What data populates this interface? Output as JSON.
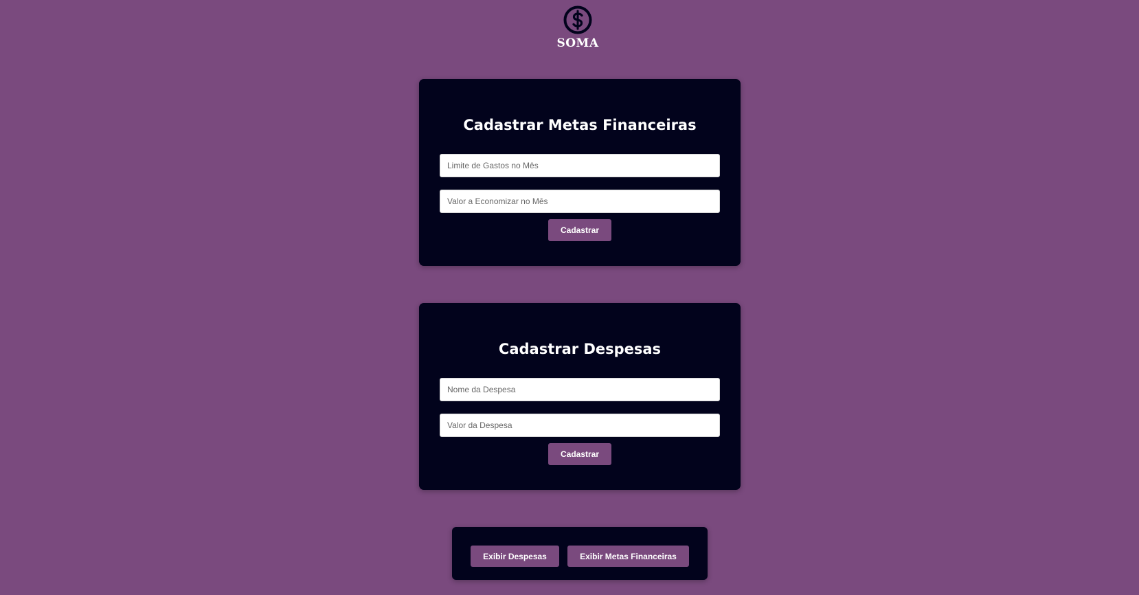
{
  "header": {
    "logo_icon": "dollar-coin-icon",
    "brand": "SOMA",
    "colors": {
      "background": "#7a4a7e",
      "card": "#02031c",
      "button": "#7a4a7e"
    }
  },
  "metas_form": {
    "title": "Cadastrar Metas Financeiras",
    "limit_placeholder": "Limite de Gastos no Mês",
    "savings_placeholder": "Valor a Economizar no Mês",
    "submit_label": "Cadastrar"
  },
  "despesas_form": {
    "title": "Cadastrar Despesas",
    "name_placeholder": "Nome da Despesa",
    "value_placeholder": "Valor da Despesa",
    "submit_label": "Cadastrar"
  },
  "actions": {
    "show_expenses_label": "Exibir Despesas",
    "show_goals_label": "Exibir Metas Financeiras"
  }
}
